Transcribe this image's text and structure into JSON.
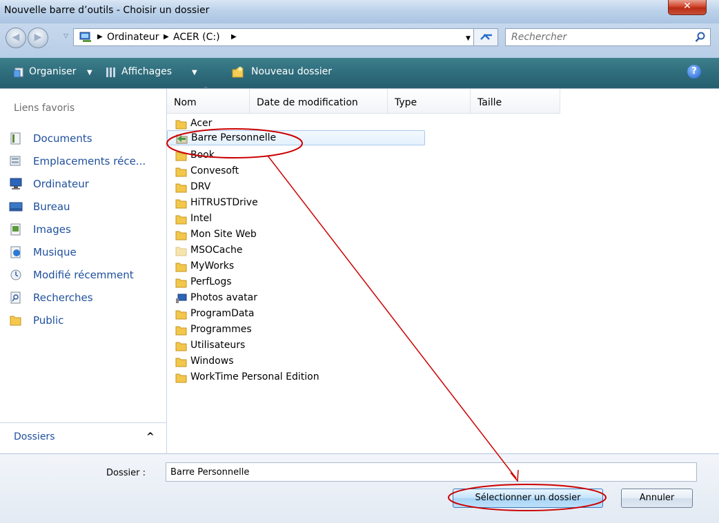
{
  "window": {
    "title": "Nouvelle barre d’outils - Choisir un dossier",
    "close_label": "✕"
  },
  "address": {
    "crumbs": [
      "Ordinateur",
      "ACER (C:)"
    ],
    "search_placeholder": "Rechercher"
  },
  "toolbar": {
    "organize": "Organiser",
    "views": "Affichages",
    "new_folder": "Nouveau dossier"
  },
  "favorites": {
    "header": "Liens favoris",
    "items": [
      {
        "label": "Documents",
        "icon": "documents-icon"
      },
      {
        "label": "Emplacements réce...",
        "icon": "recent-places-icon"
      },
      {
        "label": "Ordinateur",
        "icon": "computer-icon"
      },
      {
        "label": "Bureau",
        "icon": "desktop-icon"
      },
      {
        "label": "Images",
        "icon": "pictures-icon"
      },
      {
        "label": "Musique",
        "icon": "music-icon"
      },
      {
        "label": "Modifié récemment",
        "icon": "recently-changed-icon"
      },
      {
        "label": "Recherches",
        "icon": "searches-icon"
      },
      {
        "label": "Public",
        "icon": "public-folder-icon"
      }
    ],
    "folders_label": "Dossiers"
  },
  "columns": [
    "Nom",
    "Date de modification",
    "Type",
    "Taille"
  ],
  "files": [
    {
      "name": "Acer",
      "icon": "folder-icon"
    },
    {
      "name": "Barre Personnelle",
      "icon": "shared-folder-icon",
      "selected": true
    },
    {
      "name": "Book",
      "icon": "folder-icon"
    },
    {
      "name": "Convesoft",
      "icon": "folder-icon"
    },
    {
      "name": "DRV",
      "icon": "folder-icon"
    },
    {
      "name": "HiTRUSTDrive",
      "icon": "folder-icon"
    },
    {
      "name": "Intel",
      "icon": "folder-icon"
    },
    {
      "name": "Mon Site Web",
      "icon": "folder-icon"
    },
    {
      "name": "MSOCache",
      "icon": "hidden-folder-icon"
    },
    {
      "name": "MyWorks",
      "icon": "folder-icon"
    },
    {
      "name": "PerfLogs",
      "icon": "folder-icon"
    },
    {
      "name": "Photos avatar",
      "icon": "network-folder-icon"
    },
    {
      "name": "ProgramData",
      "icon": "folder-icon"
    },
    {
      "name": "Programmes",
      "icon": "folder-icon"
    },
    {
      "name": "Utilisateurs",
      "icon": "folder-icon"
    },
    {
      "name": "Windows",
      "icon": "folder-icon"
    },
    {
      "name": "WorkTime Personal Edition",
      "icon": "folder-icon"
    }
  ],
  "bottom": {
    "folder_label": "Dossier :",
    "folder_value": "Barre Personnelle",
    "select_button": "Sélectionner un dossier",
    "cancel_button": "Annuler"
  },
  "colors": {
    "annotation": "#cc0000",
    "toolbar": "#2f6d7c",
    "link": "#1e4f9c"
  }
}
